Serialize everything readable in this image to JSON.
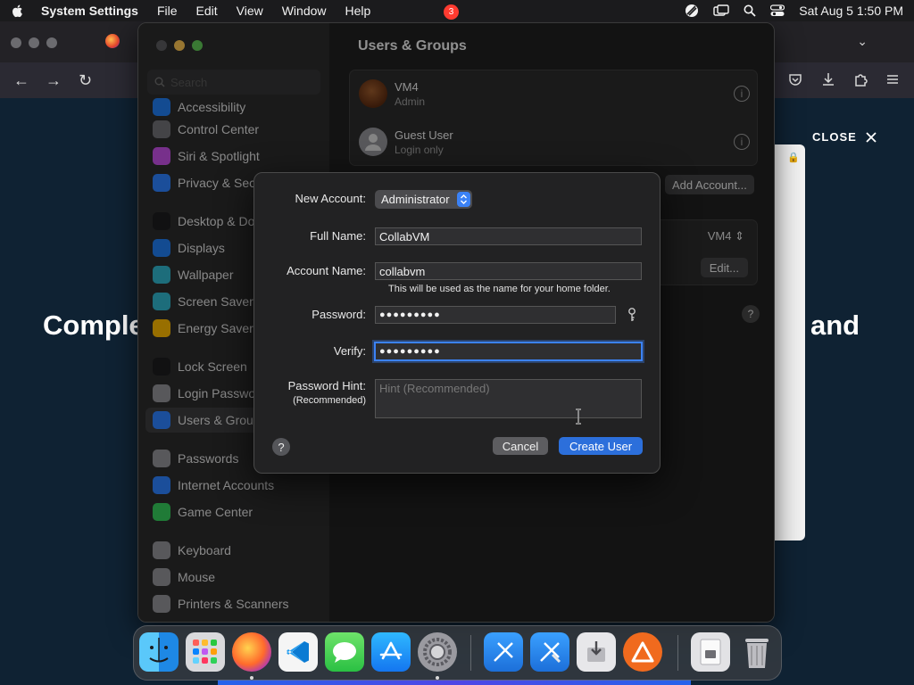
{
  "menubar": {
    "app_name": "System Settings",
    "menus": [
      "File",
      "Edit",
      "View",
      "Window",
      "Help"
    ],
    "clock": "Sat Aug 5  1:50 PM"
  },
  "browser": {
    "hero_left": "Comple",
    "hero_right": "and",
    "close_label": "CLOSE"
  },
  "settings": {
    "search_placeholder": "Search",
    "sidebar": [
      {
        "label": "Accessibility",
        "color": "#1f7aeb"
      },
      {
        "label": "Control Center",
        "color": "#6e6e73"
      },
      {
        "label": "Siri & Spotlight",
        "color": "#c04ee0"
      },
      {
        "label": "Privacy & Security",
        "color": "#2d7ff9"
      },
      {
        "label": "Desktop & Dock",
        "color": "#1c1c1e"
      },
      {
        "label": "Displays",
        "color": "#1f7aeb"
      },
      {
        "label": "Wallpaper",
        "color": "#30b0c7"
      },
      {
        "label": "Screen Saver",
        "color": "#30b0c7"
      },
      {
        "label": "Energy Saver",
        "color": "#f5b400"
      },
      {
        "label": "Lock Screen",
        "color": "#1c1c1e"
      },
      {
        "label": "Login Password",
        "color": "#8e8e93"
      },
      {
        "label": "Users & Groups",
        "color": "#2d7ff9"
      },
      {
        "label": "Passwords",
        "color": "#8e8e93"
      },
      {
        "label": "Internet Accounts",
        "color": "#2d7ff9"
      },
      {
        "label": "Game Center",
        "color": "#34c759"
      },
      {
        "label": "Keyboard",
        "color": "#8e8e93"
      },
      {
        "label": "Mouse",
        "color": "#8e8e93"
      },
      {
        "label": "Printers & Scanners",
        "color": "#8e8e93"
      }
    ],
    "main_title": "Users & Groups",
    "users": [
      {
        "name": "VM4",
        "role": "Admin"
      },
      {
        "name": "Guest User",
        "role": "Login only"
      }
    ],
    "add_account_label": "Add Account...",
    "auto_login_value": "VM4",
    "edit_label": "Edit..."
  },
  "sheet": {
    "new_account_label": "New Account:",
    "account_type": "Administrator",
    "full_name_label": "Full Name:",
    "full_name_value": "CollabVM",
    "account_name_label": "Account Name:",
    "account_name_value": "collabvm",
    "home_folder_note": "This will be used as the name for your home folder.",
    "password_label": "Password:",
    "password_value": "●●●●●●●●●",
    "verify_label": "Verify:",
    "verify_value": "●●●●●●●●●",
    "hint_label": "Password Hint:",
    "hint_sub_label": "(Recommended)",
    "hint_placeholder": "Hint (Recommended)",
    "cancel_label": "Cancel",
    "create_label": "Create User"
  },
  "dock": {
    "system_settings_badge": "3"
  },
  "colors": {
    "accent": "#2c6fdb",
    "focus_ring": "#3b82f6"
  }
}
